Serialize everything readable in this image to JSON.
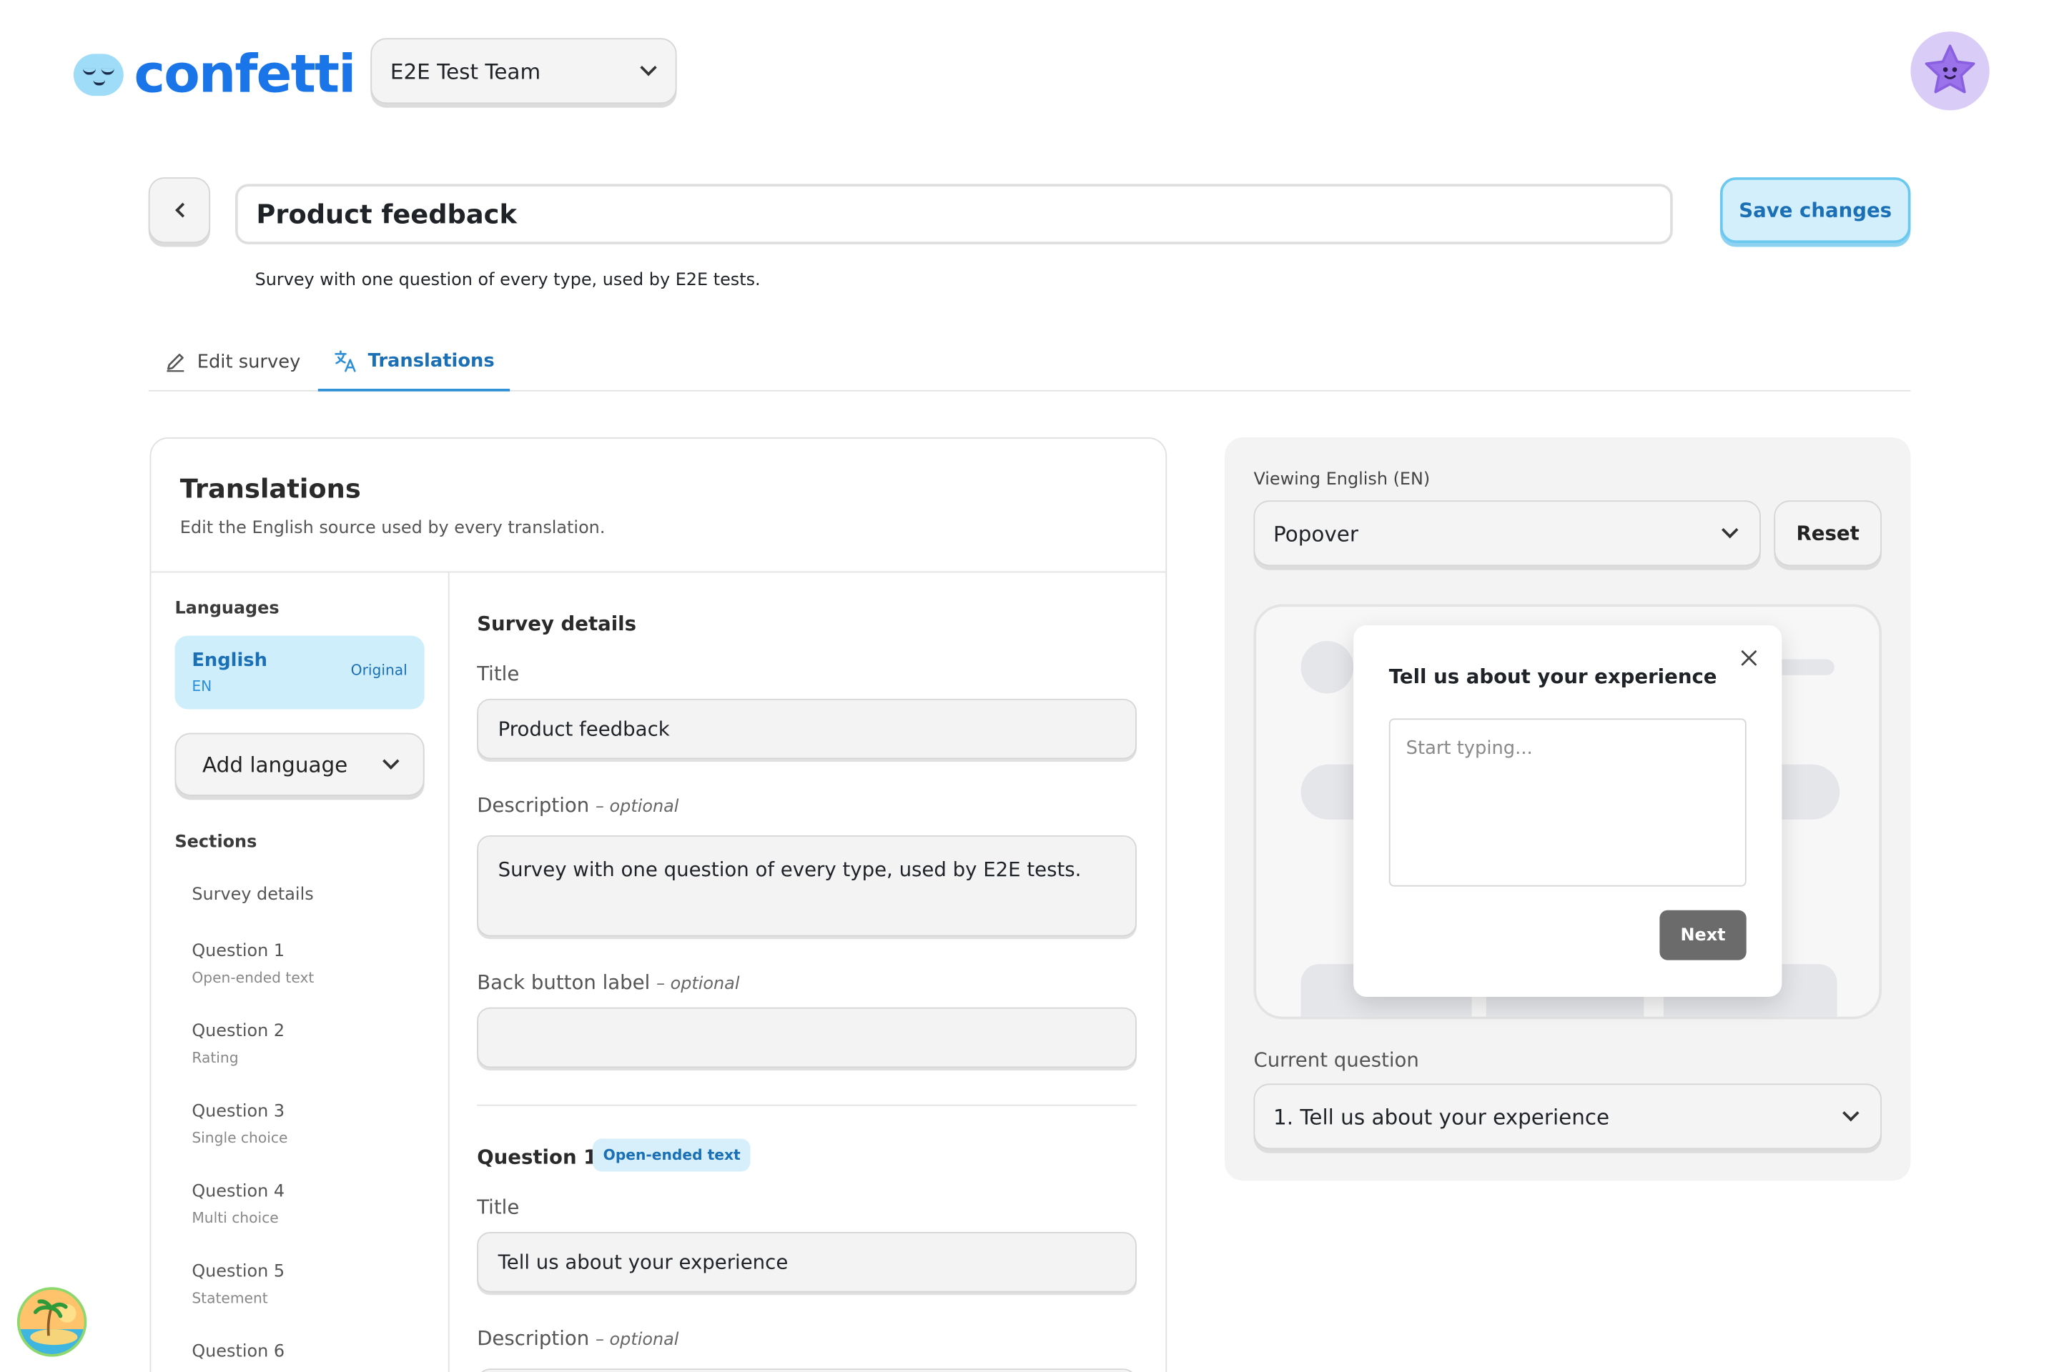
{
  "header": {
    "logo_text": "confetti",
    "team": "E2E Test Team"
  },
  "survey": {
    "title": "Product feedback",
    "description": "Survey with one question of every type, used by E2E tests.",
    "save_label": "Save changes"
  },
  "tabs": [
    {
      "label": "Edit survey",
      "icon": "pencil-icon"
    },
    {
      "label": "Translations",
      "icon": "translate-icon",
      "active": true
    }
  ],
  "translations_card": {
    "title": "Translations",
    "description": "Edit the English source used by every translation.",
    "languages_label": "Languages",
    "active_language": {
      "name": "English",
      "code": "EN",
      "tag": "Original"
    },
    "add_language_label": "Add language",
    "sections_label": "Sections",
    "sections": [
      {
        "label": "Survey details",
        "sub": ""
      },
      {
        "label": "Question 1",
        "sub": "Open-ended text"
      },
      {
        "label": "Question 2",
        "sub": "Rating"
      },
      {
        "label": "Question 3",
        "sub": "Single choice"
      },
      {
        "label": "Question 4",
        "sub": "Multi choice"
      },
      {
        "label": "Question 5",
        "sub": "Statement"
      },
      {
        "label": "Question 6",
        "sub": ""
      }
    ]
  },
  "editor": {
    "survey_details_heading": "Survey details",
    "title_label": "Title",
    "title_value": "Product feedback",
    "description_label": "Description",
    "optional_text": "– optional",
    "description_value": "Survey with one question of every type, used by E2E tests.",
    "back_button_label": "Back button label",
    "back_button_value": "",
    "question1_heading": "Question 1",
    "question1_badge": "Open-ended text",
    "q1_title_label": "Title",
    "q1_title_value": "Tell us about your experience",
    "q1_description_label": "Description"
  },
  "preview": {
    "viewing_label": "Viewing English (EN)",
    "mode": "Popover",
    "reset_label": "Reset",
    "popover_title": "Tell us about your experience",
    "placeholder": "Start typing...",
    "next_label": "Next",
    "current_question_label": "Current question",
    "current_question": "1. Tell us about your experience"
  },
  "colors": {
    "accent": "#1a6fb5",
    "accent_light": "#cfeefb",
    "logo_blue": "#1a75e8"
  }
}
